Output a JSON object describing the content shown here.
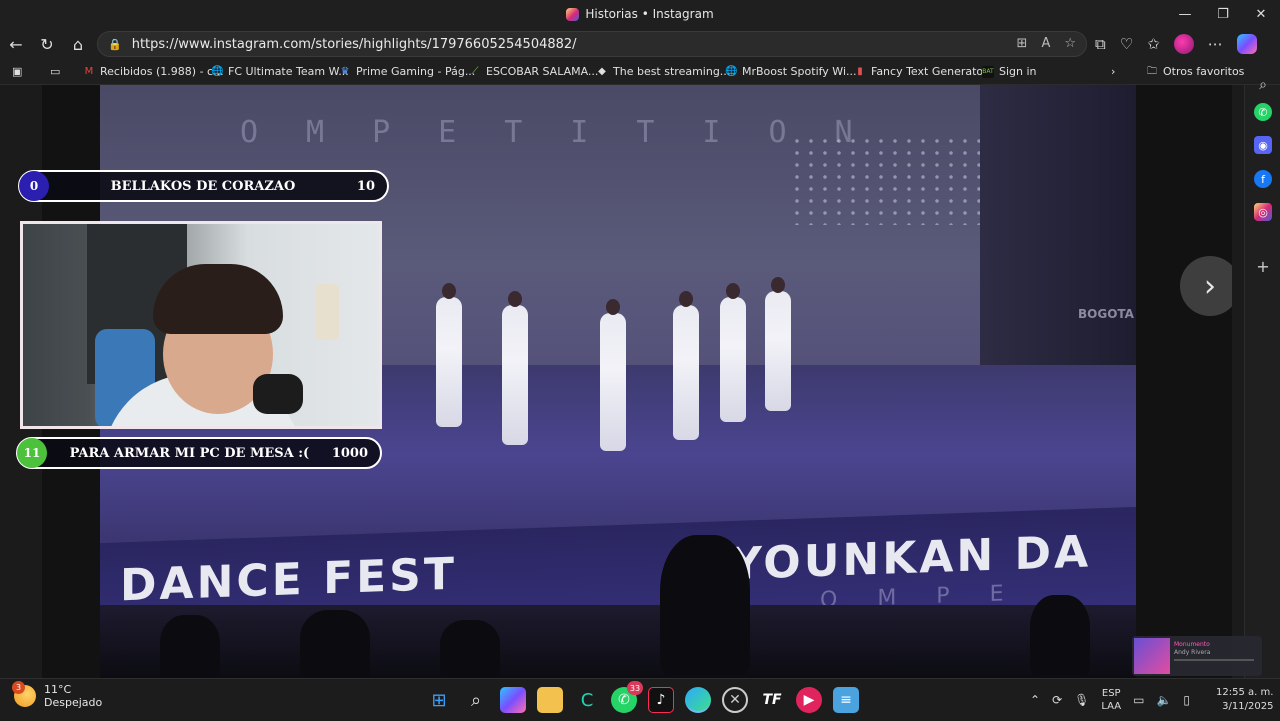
{
  "window": {
    "title": "Historias • Instagram",
    "controls": [
      "—",
      "❐",
      "✕"
    ]
  },
  "browser": {
    "url": "https://www.instagram.com/stories/highlights/17976605254504882/"
  },
  "bookmarks": [
    {
      "label": "Recibidos (1.988) - c...",
      "icon": "gmail-icon",
      "color": "#ea4335"
    },
    {
      "label": "FC Ultimate Team W...",
      "icon": "globe-icon",
      "color": "#cccccc"
    },
    {
      "label": "Prime Gaming - Pág...",
      "icon": "crown-icon",
      "color": "#5aa0ff"
    },
    {
      "label": "ESCOBAR SALAMA...",
      "icon": "feather-icon",
      "color": "#7fc34a"
    },
    {
      "label": "The best streaming...",
      "icon": "diamond-icon",
      "color": "#ffffff"
    },
    {
      "label": "MrBoost Spotify Wi...",
      "icon": "globe-icon",
      "color": "#cccccc"
    },
    {
      "label": "Fancy Text Generato...",
      "icon": "page-icon",
      "color": "#e05050"
    },
    {
      "label": "Sign in",
      "icon": "bat-icon",
      "color": "#7fc34a"
    }
  ],
  "other_favorites": "Otros favoritos",
  "overlay": {
    "top_bar": {
      "left": "0",
      "label": "BELLAKOS DE CORAZAO",
      "right": "10",
      "circle_color": "#2b1fb0"
    },
    "bottom_bar": {
      "left": "11",
      "label": "PARA ARMAR MI PC DE MESA :(",
      "right": "1000",
      "circle_color": "#4cc23c"
    }
  },
  "story": {
    "backdrop_text": "OMPETITION",
    "banner_left": "DANCE FEST",
    "banner_right": "YOUNKAN DA",
    "banner_sub": "OMPE",
    "wall_text": "BOGOTA"
  },
  "music_card": {
    "title": "Monumento",
    "artist": "Andy Rivera"
  },
  "taskbar": {
    "temperature": "11°C",
    "condition": "Despejado",
    "weather_badge": "3",
    "whatsapp_badge": "33",
    "lang_top": "ESP",
    "lang_bottom": "LAA",
    "time": "12:55 a. m.",
    "date": "3/11/2025"
  }
}
